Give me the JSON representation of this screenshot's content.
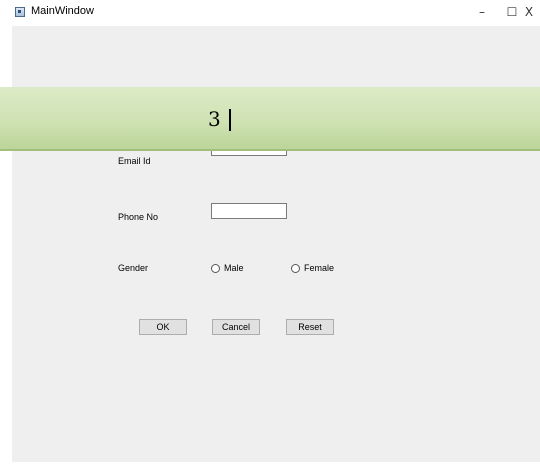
{
  "window": {
    "title": "MainWindow",
    "controls": {
      "minimize": "–",
      "maximize": "☐",
      "close": "X"
    }
  },
  "banner": {
    "text": "3"
  },
  "form": {
    "email_label": "Email Id",
    "phone_label": "Phone No",
    "phone_value": "",
    "gender_label": "Gender",
    "gender_options": [
      "Male",
      "Female"
    ]
  },
  "buttons": {
    "ok": "OK",
    "cancel": "Cancel",
    "reset": "Reset"
  },
  "colors": {
    "client_bg": "#efefef",
    "banner": "#cfe2b3"
  }
}
